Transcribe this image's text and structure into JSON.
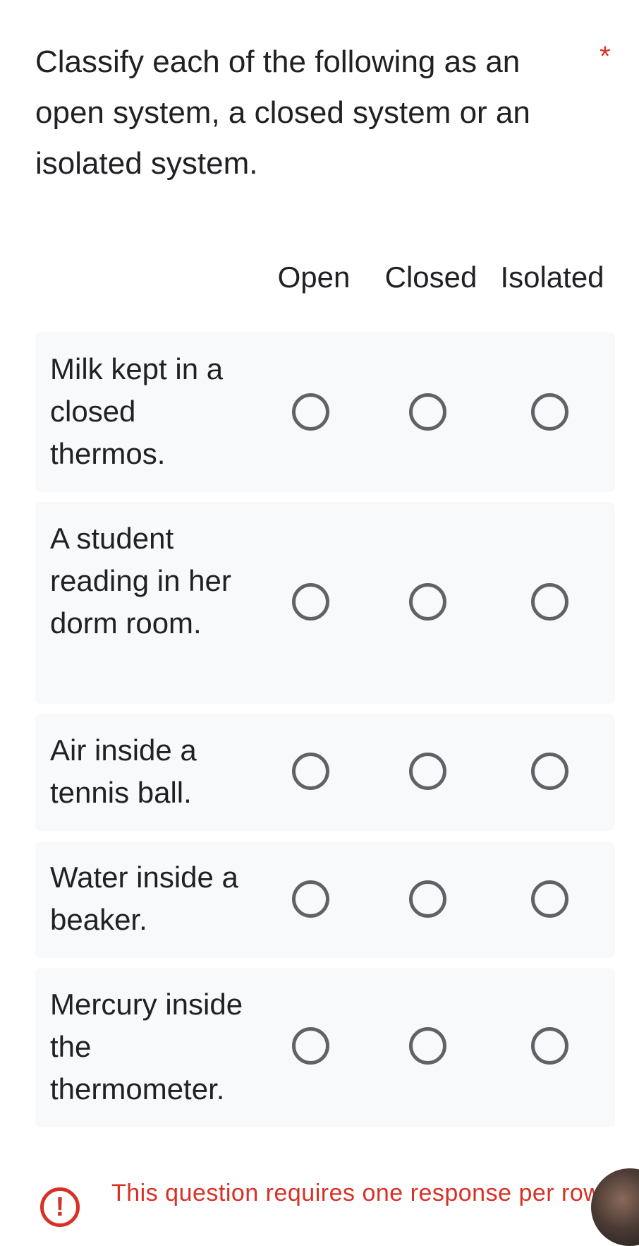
{
  "question": {
    "text": "Classify each of the following as an open system, a closed system or an isolated system.",
    "required_marker": "*"
  },
  "columns": [
    "Open",
    "Closed",
    "Isolated"
  ],
  "rows": [
    {
      "label": "Milk kept in a closed thermos."
    },
    {
      "label": "A student reading in her dorm room."
    },
    {
      "label": "Air inside a tennis ball."
    },
    {
      "label": "Water inside a beaker."
    },
    {
      "label": "Mercury inside the thermometer."
    }
  ],
  "error": {
    "icon": "error-icon",
    "text": "This question requires one response per row"
  },
  "colors": {
    "error": "#d93025",
    "row_background": "#f8f9fa",
    "radio_border": "#5f6368"
  }
}
